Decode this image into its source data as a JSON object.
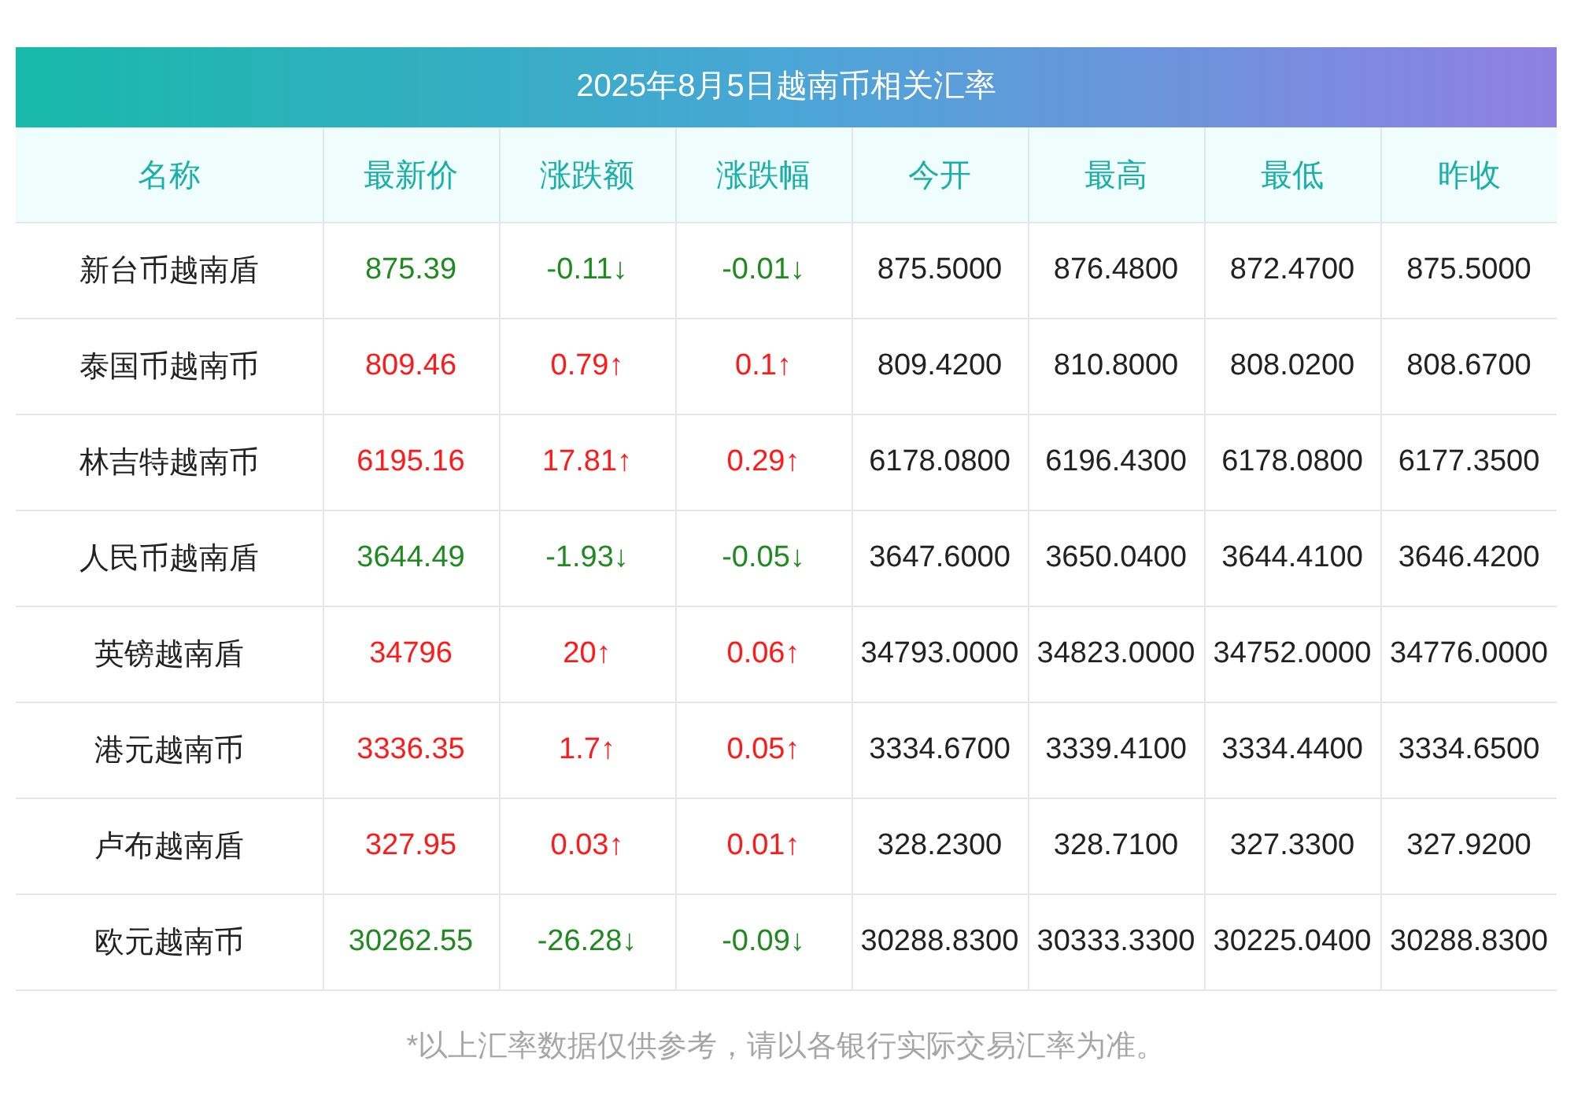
{
  "title": "2025年8月5日越南币相关汇率",
  "columns": [
    "名称",
    "最新价",
    "涨跌额",
    "涨跌幅",
    "今开",
    "最高",
    "最低",
    "昨收"
  ],
  "rows": [
    {
      "name": "新台币越南盾",
      "rising": false,
      "price": "875.39",
      "change": "-0.11↓",
      "percent": "-0.01↓",
      "open": "875.5000",
      "high": "876.4800",
      "low": "872.4700",
      "prev_close": "875.5000"
    },
    {
      "name": "泰国币越南币",
      "rising": true,
      "price": "809.46",
      "change": "0.79↑",
      "percent": "0.1↑",
      "open": "809.4200",
      "high": "810.8000",
      "low": "808.0200",
      "prev_close": "808.6700"
    },
    {
      "name": "林吉特越南币",
      "rising": true,
      "price": "6195.16",
      "change": "17.81↑",
      "percent": "0.29↑",
      "open": "6178.0800",
      "high": "6196.4300",
      "low": "6178.0800",
      "prev_close": "6177.3500"
    },
    {
      "name": "人民币越南盾",
      "rising": false,
      "price": "3644.49",
      "change": "-1.93↓",
      "percent": "-0.05↓",
      "open": "3647.6000",
      "high": "3650.0400",
      "low": "3644.4100",
      "prev_close": "3646.4200"
    },
    {
      "name": "英镑越南盾",
      "rising": true,
      "price": "34796",
      "change": "20↑",
      "percent": "0.06↑",
      "open": "34793.0000",
      "high": "34823.0000",
      "low": "34752.0000",
      "prev_close": "34776.0000"
    },
    {
      "name": "港元越南币",
      "rising": true,
      "price": "3336.35",
      "change": "1.7↑",
      "percent": "0.05↑",
      "open": "3334.6700",
      "high": "3339.4100",
      "low": "3334.4400",
      "prev_close": "3334.6500"
    },
    {
      "name": "卢布越南盾",
      "rising": true,
      "price": "327.95",
      "change": "0.03↑",
      "percent": "0.01↑",
      "open": "328.2300",
      "high": "328.7100",
      "low": "327.3300",
      "prev_close": "327.9200"
    },
    {
      "name": "欧元越南币",
      "rising": false,
      "price": "30262.55",
      "change": "-26.28↓",
      "percent": "-0.09↓",
      "open": "30288.8300",
      "high": "30333.3300",
      "low": "30225.0400",
      "prev_close": "30288.8300"
    }
  ],
  "footnote": "*以上汇率数据仅供参考，请以各银行实际交易汇率为准。"
}
